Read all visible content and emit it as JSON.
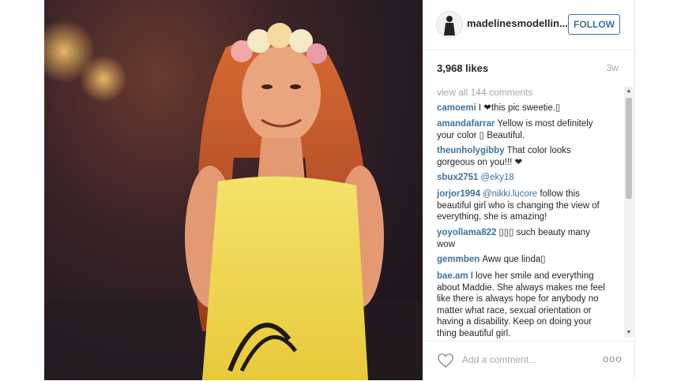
{
  "post": {
    "username": "madelinesmodellin...",
    "follow_label": "FOLLOW",
    "likes": "3,968 likes",
    "age": "3w",
    "view_all": "view all 144 comments",
    "add_comment_placeholder": "Add a comment...",
    "more_label": "ooo"
  },
  "comments": [
    {
      "user": "camoemi",
      "text": "I ❤this pic sweetie.▯"
    },
    {
      "user": "amandafarrar",
      "text": "Yellow is most definitely your color ▯ Beautiful."
    },
    {
      "user": "theunholygibby",
      "text": "That color looks gorgeous on you!!! ❤"
    },
    {
      "user": "sbux2751",
      "mention": "@eky18",
      "text": ""
    },
    {
      "user": "jorjor1994",
      "mention": "@nikki.lucore",
      "text": "follow this beautiful girl who is changing the view of everything, she is amazing!"
    },
    {
      "user": "yoyollama822",
      "text": "▯▯▯ such beauty many wow"
    },
    {
      "user": "gemmben",
      "text": "Aww que linda▯"
    },
    {
      "user": "bae.am",
      "text": "I love her smile and everything about Maddie. She always makes me feel like there is always hope for anybody no matter what race, sexual orientation or having a disability. Keep on doing your thing beautiful girl."
    }
  ],
  "colors": {
    "link_blue": "#3f729b",
    "muted_gray": "#a5a7aa",
    "text_dark": "#262626"
  },
  "icons": [
    "heart-icon",
    "more-options-icon",
    "scroll-up-arrow",
    "scroll-down-arrow"
  ]
}
